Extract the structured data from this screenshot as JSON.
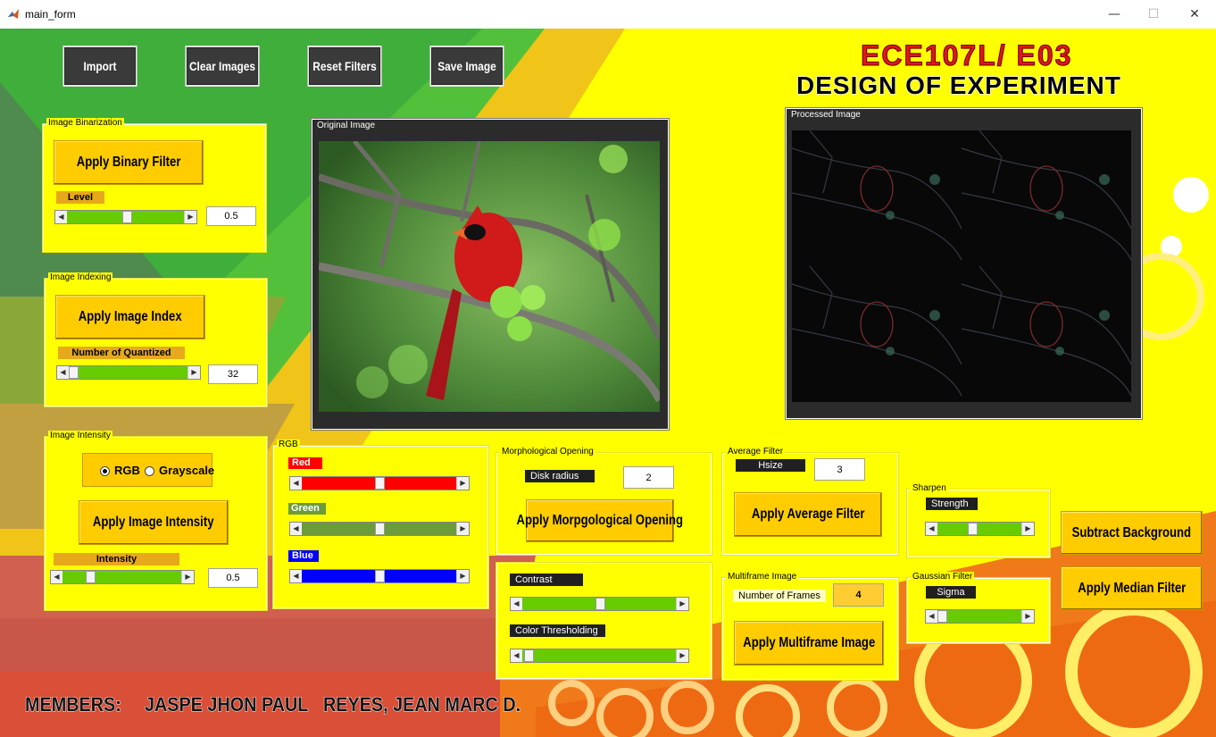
{
  "window": {
    "title": "main_form",
    "minimize": "—",
    "maximize": "☐",
    "close": "✕"
  },
  "toolbar": {
    "import": "Import",
    "clear_images": "Clear Images",
    "reset_filters": "Reset Filters",
    "save_image": "Save Image"
  },
  "header": {
    "line1": "ECE107L/ E03",
    "line2": "DESIGN OF EXPERIMENT"
  },
  "binarization": {
    "title": "Image Binarization",
    "button": "Apply Binary Filter",
    "level_label": "Level",
    "level_value": "0.5",
    "slider_fraction": 0.5
  },
  "indexing": {
    "title": "Image Indexing",
    "button": "Apply Image Index",
    "quant_label": "Number of Quantized",
    "quant_value": "32",
    "slider_fraction": 0.0
  },
  "original": {
    "title": "Original Image"
  },
  "processed": {
    "title": "Processed Image"
  },
  "intensity": {
    "title": "Image Intensity",
    "radio_rgb": "RGB",
    "radio_gray": "Grayscale",
    "selected": "RGB",
    "button": "Apply Image Intensity",
    "intensity_label": "Intensity",
    "intensity_value": "0.5",
    "slider_fraction": 0.2
  },
  "rgb": {
    "title": "RGB",
    "red_label": "Red",
    "green_label": "Green",
    "blue_label": "Blue",
    "red_fraction": 0.5,
    "green_fraction": 0.5,
    "blue_fraction": 0.5,
    "red_color": "#ff0000",
    "green_color": "#6b9b3a",
    "blue_color": "#0000ff"
  },
  "morph": {
    "title": "Morphological Opening",
    "disk_label": "Disk radius",
    "disk_value": "2",
    "button": "Apply Morpgological Opening"
  },
  "contrast": {
    "contrast_label": "Contrast",
    "contrast_fraction": 0.5,
    "threshold_label": "Color Thresholding",
    "threshold_fraction": 0.0
  },
  "average": {
    "title": "Average Filter",
    "hsize_label": "Hsize",
    "hsize_value": "3",
    "button": "Apply Average Filter"
  },
  "multiframe": {
    "title": "Multiframe Image",
    "frames_label": "Number of Frames",
    "frames_value": "4",
    "button": "Apply Multiframe Image"
  },
  "sharpen": {
    "title": "Sharpen",
    "strength_label": "Strength",
    "strength_fraction": 0.4
  },
  "gaussian": {
    "title": "Gaussian Filter",
    "sigma_label": "Sigma",
    "sigma_fraction": 0.0
  },
  "side_buttons": {
    "subtract": "Subtract Background",
    "median": "Apply Median Filter"
  },
  "footer": {
    "members_label": "MEMBERS:",
    "member1": "JASPE JHON PAUL",
    "member2": "REYES, JEAN MARC D."
  },
  "colors": {
    "slider_green": "#66cc00",
    "panel_yellow": "#ffff00",
    "button_gold": "#ffcc00",
    "label_orange": "#e8a81c"
  },
  "icons": {
    "app": "matlab-icon",
    "minimize": "minimize-icon",
    "maximize": "maximize-icon",
    "close": "close-icon"
  }
}
